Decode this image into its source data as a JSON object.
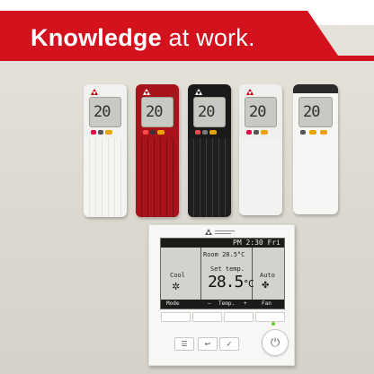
{
  "banner": {
    "bold": "Knowledge",
    "rest": " at work."
  },
  "remotes": [
    {
      "id": "white",
      "body": "#f1f1ef",
      "digits": "20"
    },
    {
      "id": "red",
      "body": "#a8121b",
      "digits": "20"
    },
    {
      "id": "black",
      "body": "#1a1a1a",
      "digits": "20"
    },
    {
      "id": "silver",
      "body": "#efefed",
      "digits": "20"
    },
    {
      "id": "classic",
      "body": "#f6f6f5",
      "digits": "20"
    }
  ],
  "controller": {
    "clock": "PM 2:30 Fri",
    "room": "Room 28.5°C",
    "mode_value": "Cool",
    "set_label": "Set temp.",
    "set_value": "28.5",
    "unit": "°C",
    "fan_value": "Auto",
    "footer": {
      "mode": "Mode",
      "minus": "–",
      "temp": "Temp.",
      "plus": "+",
      "fan": "Fan"
    }
  },
  "colors": {
    "brand_red": "#d4121e"
  }
}
